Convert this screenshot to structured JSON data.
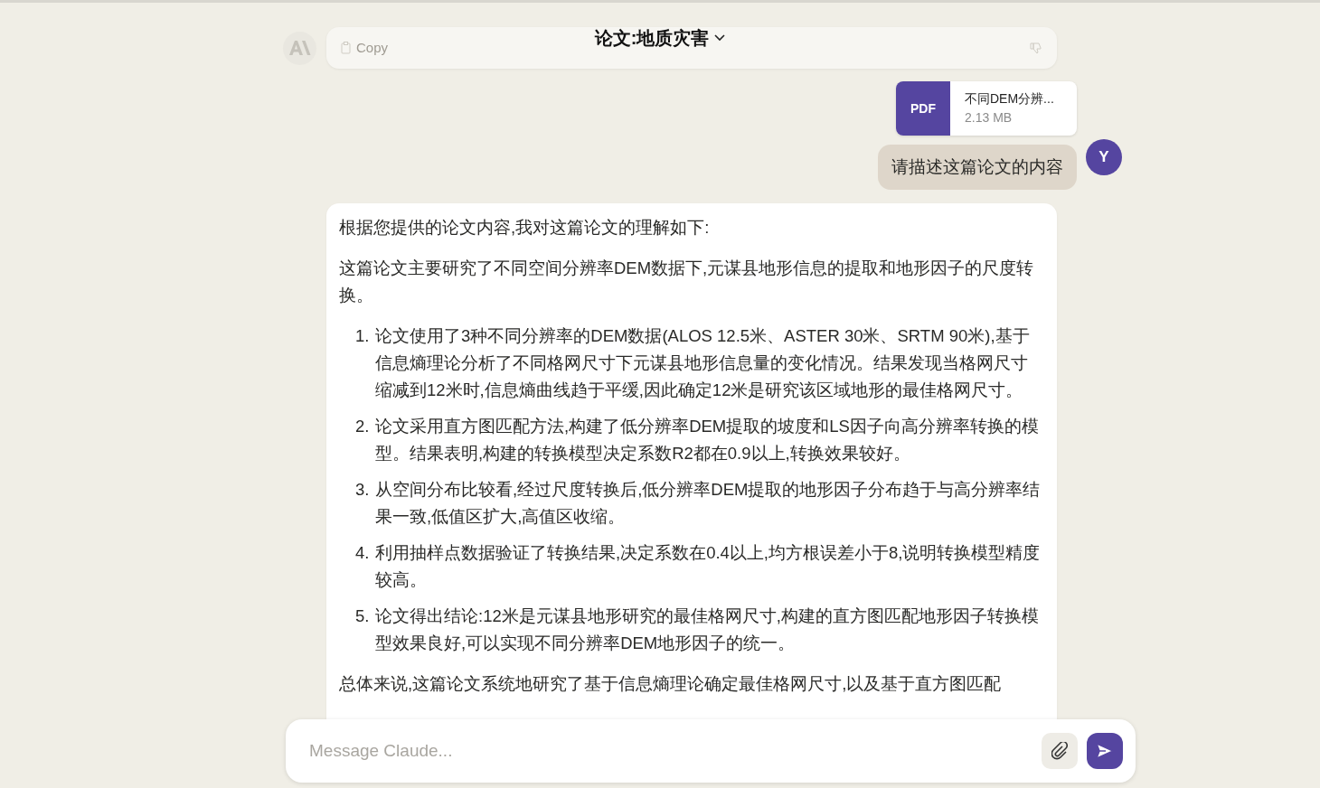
{
  "header": {
    "title": "论文:地质灾害"
  },
  "previous_message": {
    "copy_label": "Copy"
  },
  "attachment": {
    "badge": "PDF",
    "name": "不同DEM分辨...",
    "size": "2.13 MB"
  },
  "user_message": {
    "avatar": "Y",
    "text": "请描述这篇论文的内容"
  },
  "reply": {
    "intro": "根据您提供的论文内容,我对这篇论文的理解如下:",
    "summary": "这篇论文主要研究了不同空间分辨率DEM数据下,元谋县地形信息的提取和地形因子的尺度转换。",
    "points": [
      {
        "number": "1.",
        "text": "论文使用了3种不同分辨率的DEM数据(ALOS 12.5米、ASTER 30米、SRTM 90米),基于信息熵理论分析了不同格网尺寸下元谋县地形信息量的变化情况。结果发现当格网尺寸缩减到12米时,信息熵曲线趋于平缓,因此确定12米是研究该区域地形的最佳格网尺寸。"
      },
      {
        "number": "2.",
        "text": "论文采用直方图匹配方法,构建了低分辨率DEM提取的坡度和LS因子向高分辨率转换的模型。结果表明,构建的转换模型决定系数R2都在0.9以上,转换效果较好。"
      },
      {
        "number": "3.",
        "text": "从空间分布比较看,经过尺度转换后,低分辨率DEM提取的地形因子分布趋于与高分辨率结果一致,低值区扩大,高值区收缩。"
      },
      {
        "number": "4.",
        "text": "利用抽样点数据验证了转换结果,决定系数在0.4以上,均方根误差小于8,说明转换模型精度较高。"
      },
      {
        "number": "5.",
        "text": "论文得出结论:12米是元谋县地形研究的最佳格网尺寸,构建的直方图匹配地形因子转换模型效果良好,可以实现不同分辨率DEM地形因子的统一。"
      }
    ],
    "closing": "总体来说,这篇论文系统地研究了基于信息熵理论确定最佳格网尺寸,以及基于直方图匹配"
  },
  "composer": {
    "placeholder": "Message Claude..."
  }
}
